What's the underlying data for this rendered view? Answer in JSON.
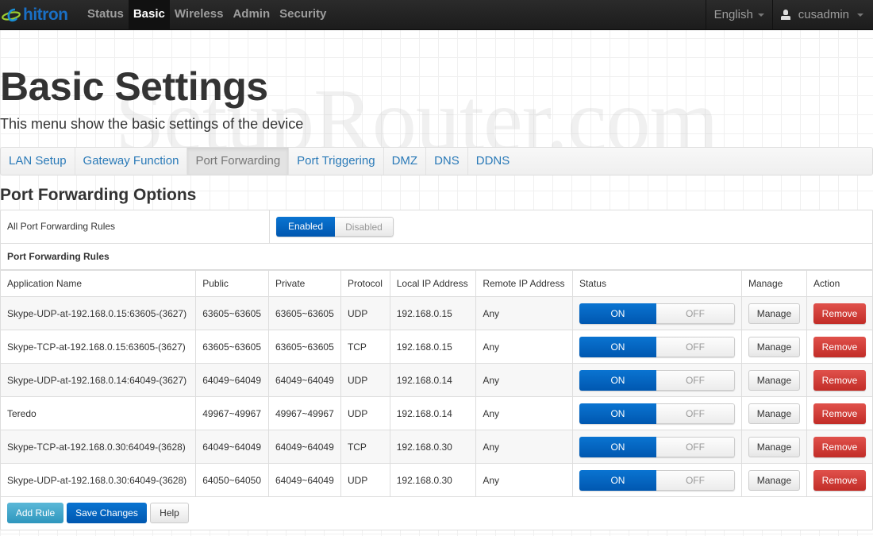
{
  "navbar": {
    "brand": "hitron",
    "items": [
      {
        "label": "Status",
        "active": false
      },
      {
        "label": "Basic",
        "active": true
      },
      {
        "label": "Wireless",
        "active": false
      },
      {
        "label": "Admin",
        "active": false
      },
      {
        "label": "Security",
        "active": false
      }
    ],
    "language": "English",
    "user": "cusadmin"
  },
  "watermark": "SetupRouter.com",
  "page": {
    "title": "Basic Settings",
    "subtitle": "This menu show the basic settings of the device"
  },
  "tabs": [
    {
      "label": "LAN Setup",
      "active": false
    },
    {
      "label": "Gateway Function",
      "active": false
    },
    {
      "label": "Port Forwarding",
      "active": true
    },
    {
      "label": "Port Triggering",
      "active": false
    },
    {
      "label": "DMZ",
      "active": false
    },
    {
      "label": "DNS",
      "active": false
    },
    {
      "label": "DDNS",
      "active": false
    }
  ],
  "section": {
    "title": "Port Forwarding Options",
    "all_rules_label": "All Port Forwarding Rules",
    "enabled_label": "Enabled",
    "disabled_label": "Disabled",
    "all_rules_state": "Enabled",
    "rules_title": "Port Forwarding Rules"
  },
  "table": {
    "headers": [
      "Application Name",
      "Public",
      "Private",
      "Protocol",
      "Local IP Address",
      "Remote IP Address",
      "Status",
      "Manage",
      "Action"
    ],
    "on_label": "ON",
    "off_label": "OFF",
    "manage_label": "Manage",
    "remove_label": "Remove",
    "rows": [
      {
        "name": "Skype-UDP-at-192.168.0.15:63605-(3627)",
        "public": "63605~63605",
        "private": "63605~63605",
        "protocol": "UDP",
        "local_ip": "192.168.0.15",
        "remote_ip": "Any",
        "status": "ON"
      },
      {
        "name": "Skype-TCP-at-192.168.0.15:63605-(3627)",
        "public": "63605~63605",
        "private": "63605~63605",
        "protocol": "TCP",
        "local_ip": "192.168.0.15",
        "remote_ip": "Any",
        "status": "ON"
      },
      {
        "name": "Skype-UDP-at-192.168.0.14:64049-(3627)",
        "public": "64049~64049",
        "private": "64049~64049",
        "protocol": "UDP",
        "local_ip": "192.168.0.14",
        "remote_ip": "Any",
        "status": "ON"
      },
      {
        "name": "Teredo",
        "public": "49967~49967",
        "private": "49967~49967",
        "protocol": "UDP",
        "local_ip": "192.168.0.14",
        "remote_ip": "Any",
        "status": "ON"
      },
      {
        "name": "Skype-TCP-at-192.168.0.30:64049-(3628)",
        "public": "64049~64049",
        "private": "64049~64049",
        "protocol": "TCP",
        "local_ip": "192.168.0.30",
        "remote_ip": "Any",
        "status": "ON"
      },
      {
        "name": "Skype-UDP-at-192.168.0.30:64049-(3628)",
        "public": "64050~64050",
        "private": "64049~64049",
        "protocol": "UDP",
        "local_ip": "192.168.0.30",
        "remote_ip": "Any",
        "status": "ON"
      }
    ]
  },
  "footer": {
    "add_rule": "Add Rule",
    "save_changes": "Save Changes",
    "help": "Help"
  }
}
